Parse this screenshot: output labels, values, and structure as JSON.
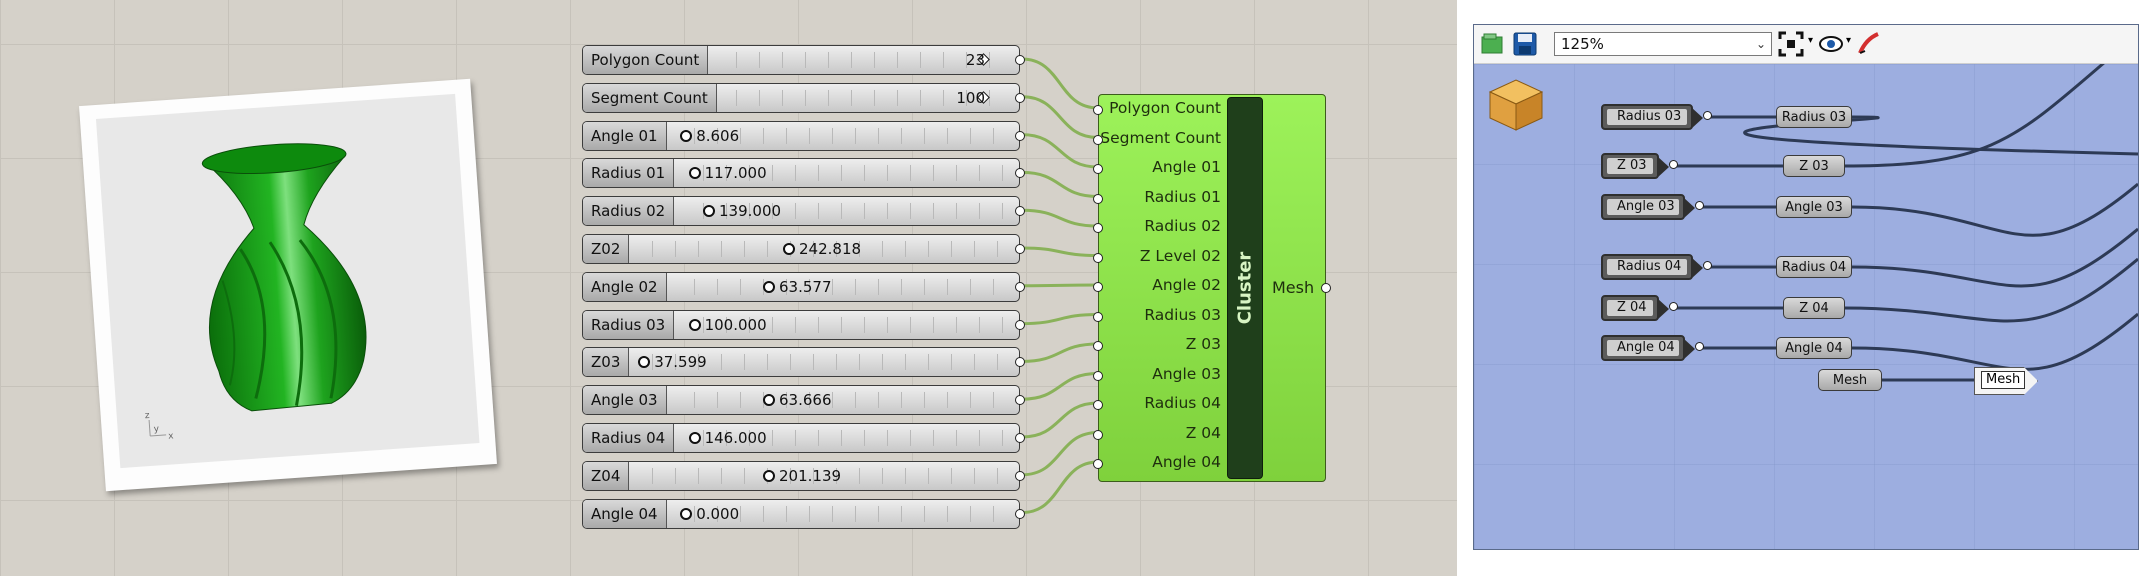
{
  "sliders": [
    {
      "label": "Polygon Count",
      "value": "23",
      "marker": "diamond"
    },
    {
      "label": "Segment Count",
      "value": "100",
      "marker": "diamond"
    },
    {
      "label": "Angle 01",
      "value": "8.606",
      "marker": "circle"
    },
    {
      "label": "Radius 01",
      "value": "117.000",
      "marker": "circle"
    },
    {
      "label": "Radius 02",
      "value": "139.000",
      "marker": "circle"
    },
    {
      "label": "Z02",
      "value": "242.818",
      "marker": "circle"
    },
    {
      "label": "Angle 02",
      "value": "63.577",
      "marker": "circle"
    },
    {
      "label": "Radius 03",
      "value": "100.000",
      "marker": "circle"
    },
    {
      "label": "Z03",
      "value": "37.599",
      "marker": "circle"
    },
    {
      "label": "Angle 03",
      "value": "63.666",
      "marker": "circle"
    },
    {
      "label": "Radius 04",
      "value": "146.000",
      "marker": "circle"
    },
    {
      "label": "Z04",
      "value": "201.139",
      "marker": "circle"
    },
    {
      "label": "Angle 04",
      "value": "0.000",
      "marker": "circle"
    }
  ],
  "cluster": {
    "title": "Cluster",
    "inputs": [
      "Polygon Count",
      "Segment Count",
      "Angle 01",
      "Radius 01",
      "Radius 02",
      "Z Level 02",
      "Angle 02",
      "Radius 03",
      "Z 03",
      "Angle 03",
      "Radius 04",
      "Z 04",
      "Angle 04"
    ],
    "output": "Mesh",
    "color": "#8fe34a"
  },
  "viewport": {
    "axis_labels": {
      "x": "x",
      "y": "y",
      "z": "z"
    },
    "mesh_color": "#1aa81a"
  },
  "cluster_editor": {
    "zoom": "125%",
    "toolbar_icons": [
      "open-icon",
      "save-icon",
      "zoom-extents-icon",
      "preview-eye-icon",
      "sketch-icon"
    ],
    "input_params": [
      "Radius 03",
      "Z 03",
      "Angle 03",
      "Radius 04",
      "Z 04",
      "Angle 04"
    ],
    "relay_params": [
      "Radius 03",
      "Z 03",
      "Angle 03",
      "Radius 04",
      "Z 04",
      "Angle 04"
    ],
    "mesh_param": "Mesh",
    "output_param": "Mesh",
    "background_color": "#9daee0"
  }
}
